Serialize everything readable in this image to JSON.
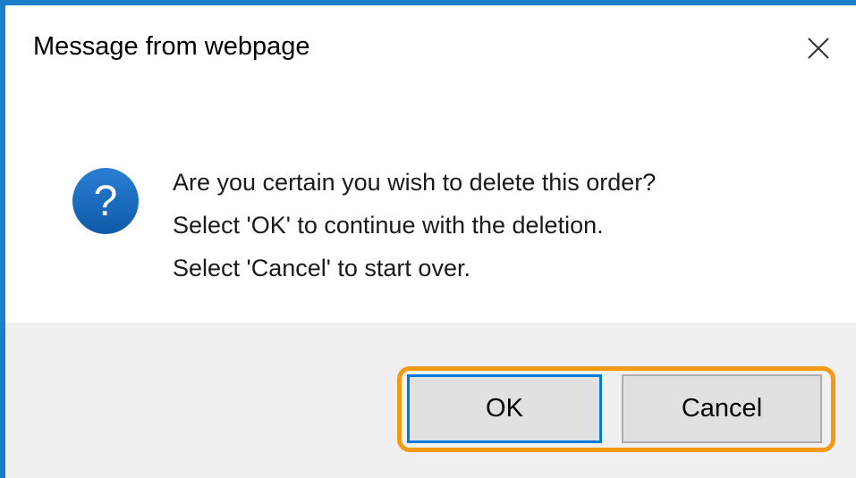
{
  "dialog": {
    "title": "Message from webpage",
    "close_icon": "close-x-icon",
    "message_icon": "question-circle-icon",
    "message_lines": [
      "Are you certain you wish to delete this order?",
      "Select 'OK' to continue with the deletion.",
      "Select 'Cancel' to start over."
    ],
    "buttons": {
      "ok_label": "OK",
      "cancel_label": "Cancel"
    }
  },
  "colors": {
    "background": "#1a7fc8",
    "dialog": "#ffffff",
    "footer": "#f0f0f0",
    "highlight": "#f29a14",
    "focus_border": "#0078d7",
    "question_icon": "#1565c0"
  }
}
